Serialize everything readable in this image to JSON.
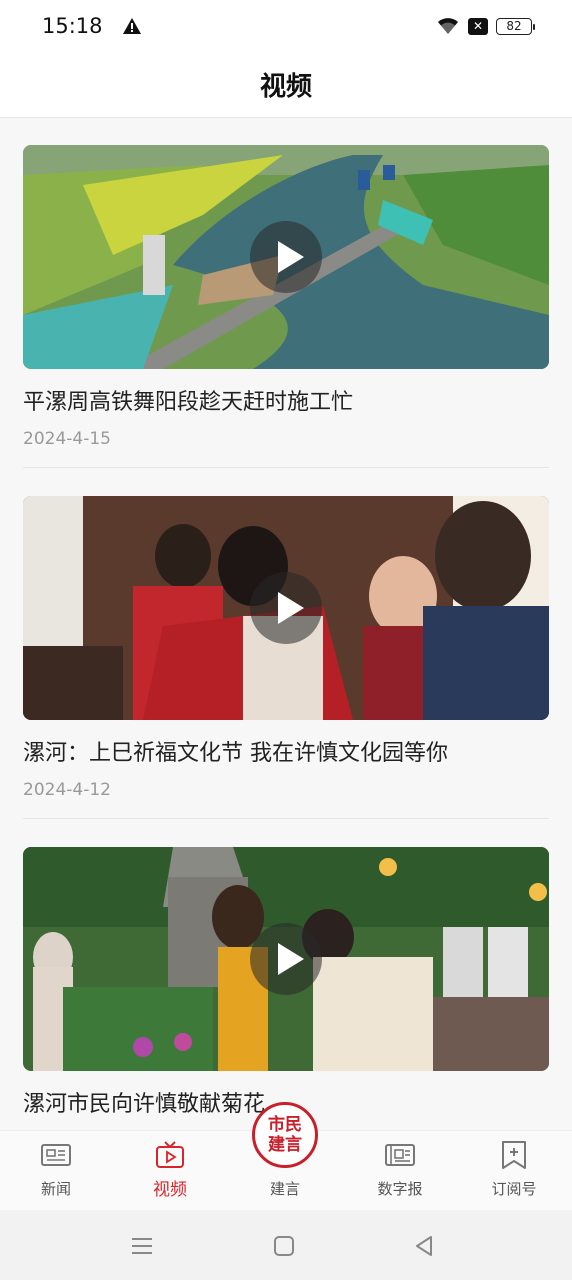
{
  "status": {
    "time": "15:18",
    "battery": "82"
  },
  "header": {
    "title": "视频"
  },
  "videos": [
    {
      "title": "平漯周高铁舞阳段趁天赶时施工忙",
      "date": "2024-4-15"
    },
    {
      "title": "漯河：上巳祈福文化节  我在许慎文化园等你",
      "date": "2024-4-12"
    },
    {
      "title": "漯河市民向许慎敬献菊花",
      "date": ""
    }
  ],
  "tabs": [
    {
      "label": "新闻",
      "icon": "news-icon"
    },
    {
      "label": "视频",
      "icon": "video-icon",
      "active": true
    },
    {
      "label": "建言",
      "icon": "suggestion-seal-icon",
      "seal_text": "市民建言"
    },
    {
      "label": "数字报",
      "icon": "digital-newspaper-icon"
    },
    {
      "label": "订阅号",
      "icon": "subscription-icon"
    }
  ],
  "colors": {
    "accent": "#d7262b"
  }
}
